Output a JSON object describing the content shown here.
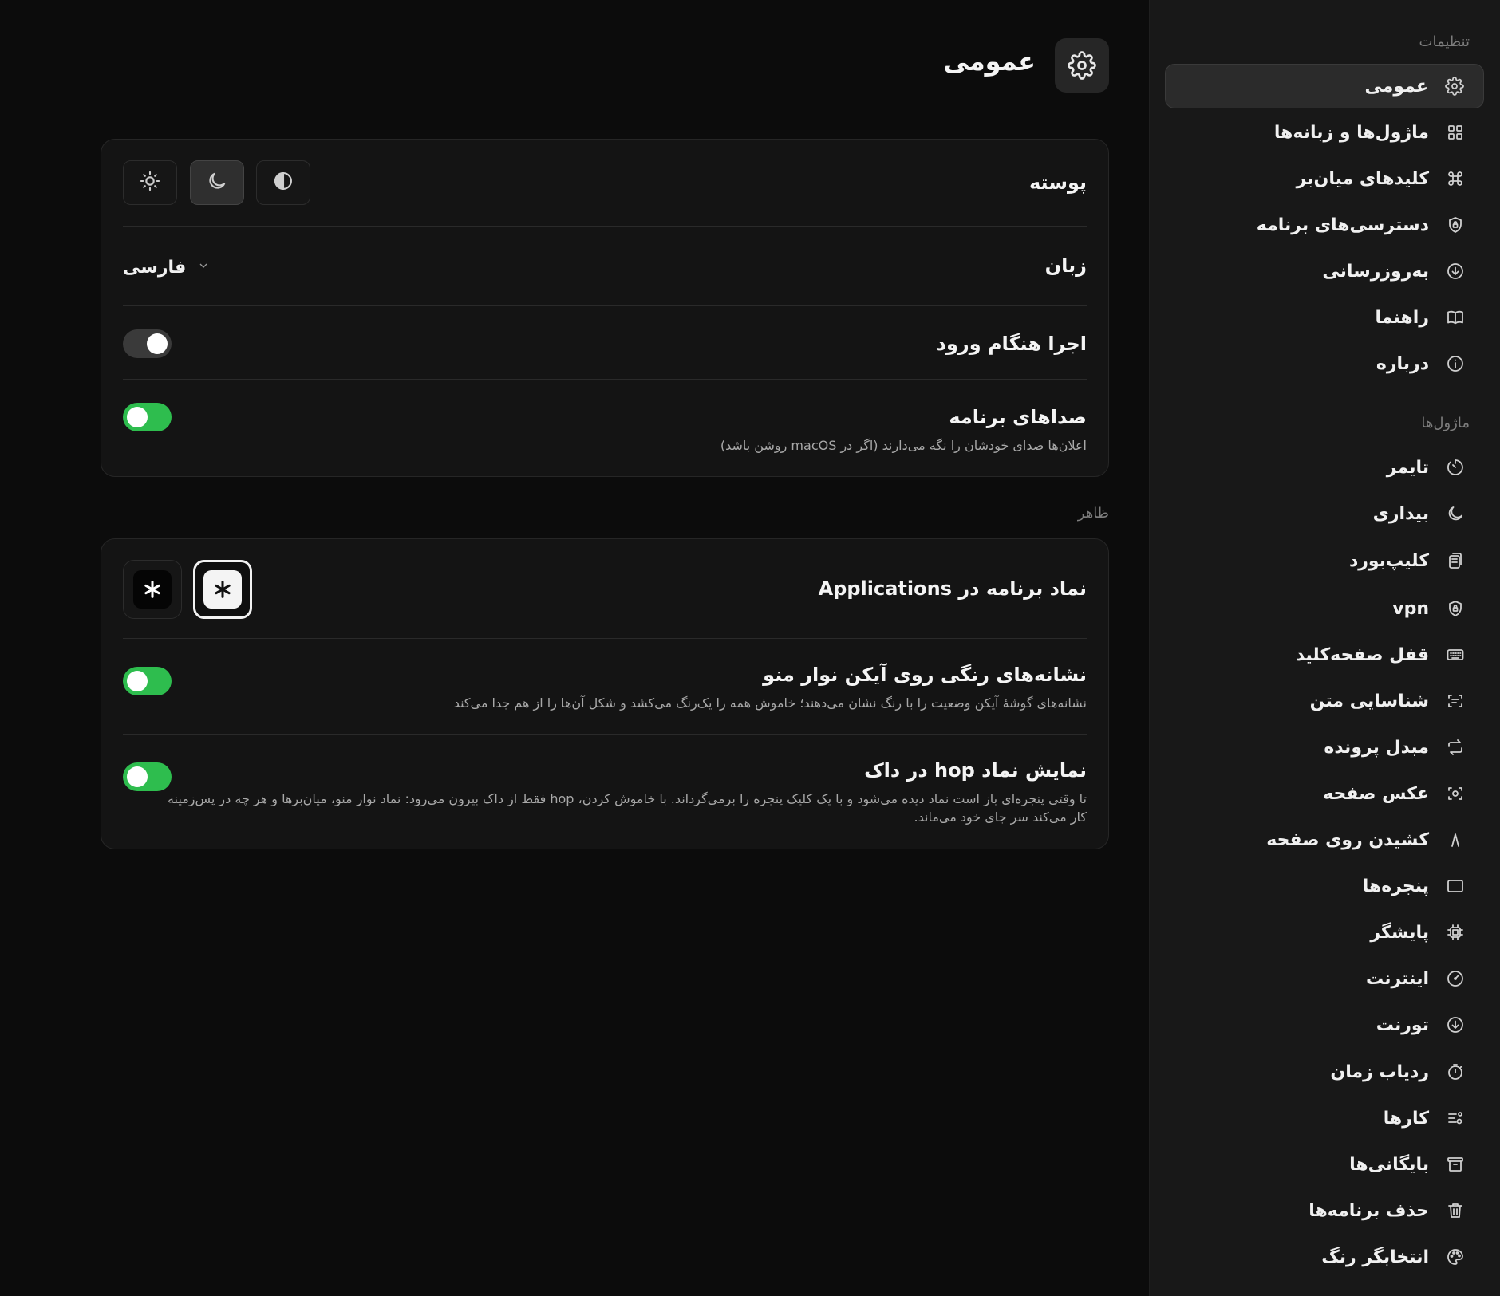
{
  "sidebar": {
    "settings_header": "تنظیمات",
    "modules_header": "ماژول‌ها",
    "items": [
      {
        "label": "عمومی",
        "icon": "gear-icon",
        "active": true
      },
      {
        "label": "ماژول‌ها و زبانه‌ها",
        "icon": "grid-icon"
      },
      {
        "label": "کلیدهای میان‌بر",
        "icon": "command-key-icon"
      },
      {
        "label": "دسترسی‌های برنامه",
        "icon": "shield-lock-icon"
      },
      {
        "label": "به‌روزرسانی",
        "icon": "download-circle-icon"
      },
      {
        "label": "راهنما",
        "icon": "book-icon"
      },
      {
        "label": "درباره",
        "icon": "info-icon"
      }
    ],
    "modules": [
      {
        "label": "تایمر",
        "icon": "timer-icon"
      },
      {
        "label": "بیداری",
        "icon": "moon-icon"
      },
      {
        "label": "کلیپ‌بورد",
        "icon": "clipboard-icon"
      },
      {
        "label": "vpn",
        "icon": "shield-lock-icon"
      },
      {
        "label": "قفل صفحه‌کلید",
        "icon": "keyboard-icon"
      },
      {
        "label": "شناسایی متن",
        "icon": "text-scan-icon"
      },
      {
        "label": "مبدل پرونده",
        "icon": "convert-icon"
      },
      {
        "label": "عکس صفحه",
        "icon": "screenshot-icon"
      },
      {
        "label": "کشیدن روی صفحه",
        "icon": "draw-icon"
      },
      {
        "label": "پنجره‌ها",
        "icon": "window-icon"
      },
      {
        "label": "پایشگر",
        "icon": "cpu-icon"
      },
      {
        "label": "اینترنت",
        "icon": "speedometer-icon"
      },
      {
        "label": "تورنت",
        "icon": "download-circle-icon"
      },
      {
        "label": "ردیاب زمان",
        "icon": "stopwatch-icon"
      },
      {
        "label": "کارها",
        "icon": "tasks-icon"
      },
      {
        "label": "بایگانی‌ها",
        "icon": "archive-icon"
      },
      {
        "label": "حذف برنامه‌ها",
        "icon": "trash-icon"
      },
      {
        "label": "انتخابگر رنگ",
        "icon": "palette-icon"
      }
    ]
  },
  "main": {
    "title": "عمومی",
    "card1": {
      "theme_label": "پوسته",
      "theme_options": [
        "sun-icon",
        "moon-icon",
        "half-circle-icon"
      ],
      "theme_selected": "moon-icon",
      "language_label": "زبان",
      "language_value": "فارسی",
      "launch_label": "اجرا هنگام ورود",
      "launch_on": false,
      "sounds_label": "صداهای برنامه",
      "sounds_desc": "اعلان‌ها صدای خودشان را نگه می‌دارند (اگر در macOS روشن باشد)",
      "sounds_on": true
    },
    "appearance_label": "ظاهر",
    "card2": {
      "appicon_label": "نماد برنامه در Applications",
      "appicon_selected": "light",
      "badges_label": "نشانه‌های رنگی روی آیکن نوار منو",
      "badges_desc": "نشانه‌های گوشهٔ آیکن وضعیت را با رنگ نشان می‌دهند؛ خاموش همه را یک‌رنگ می‌کشد و شکل آن‌ها را از هم جدا می‌کند",
      "badges_on": true,
      "dock_label": "نمایش نماد hop در داک",
      "dock_desc": "تا وقتی پنجره‌ای باز است نماد دیده می‌شود و با یک کلیک پنجره را برمی‌گرداند. با خاموش کردن، hop فقط از داک بیرون می‌رود: نماد نوار منو، میان‌برها و هر چه در پس‌زمینه کار می‌کند سر جای خود می‌ماند.",
      "dock_on": true
    }
  },
  "colors": {
    "accent_green": "#2ebd4e",
    "background": "#0c0c0c",
    "sidebar": "#181818"
  }
}
